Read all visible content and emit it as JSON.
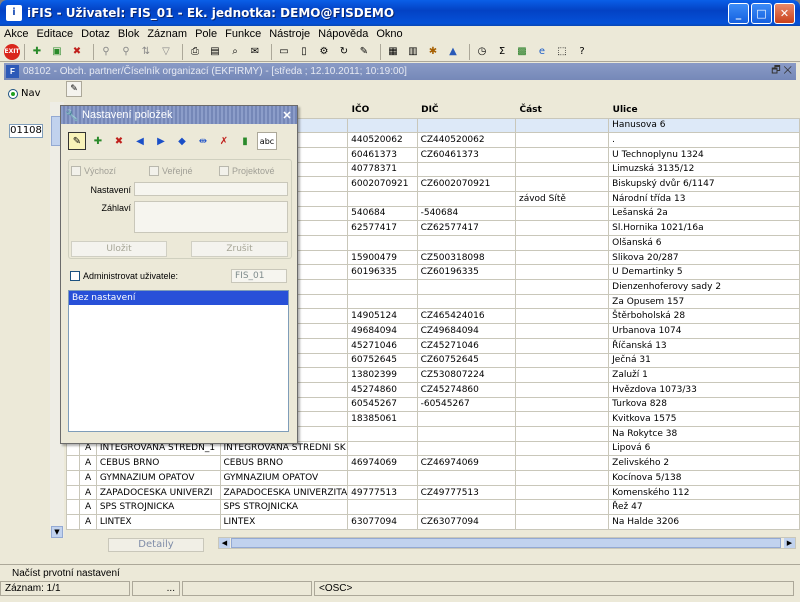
{
  "window": {
    "title": "iFIS - Uživatel: FIS_01 - Ek. jednotka: DEMO@FISDEMO",
    "app_icon": "iFIS"
  },
  "menu": [
    "Akce",
    "Editace",
    "Dotaz",
    "Blok",
    "Záznam",
    "Pole",
    "Funkce",
    "Nástroje",
    "Nápověda",
    "Okno"
  ],
  "toolbar": {
    "exit_label": "EXIT"
  },
  "inner_window": {
    "title": "08102 - Obch. partner/Číselník organizací (EKFIRMY) - [středa ; 12.10.2011; 10:19:00]",
    "controls": "🗗 ✕"
  },
  "left_panel": {
    "nav_label": "Nav",
    "number": "01108",
    "detail_button": "Detaily"
  },
  "grid": {
    "headers": [
      "",
      "",
      "",
      "",
      "IČO",
      "DIČ",
      "Část",
      "Ulice"
    ],
    "rows": [
      {
        "f": "",
        "n": "",
        "n2": "",
        "ico": "",
        "dic": "",
        "cast": "",
        "ulice": "Hanusova 6"
      },
      {
        "f": "",
        "n": "",
        "n2": "MERA",
        "ico": "440520062",
        "dic": "CZ440520062",
        "cast": "",
        "ulice": "."
      },
      {
        "f": "",
        "n": "",
        "n2": "CHENIE A",
        "ico": "60461373",
        "dic": "CZ60461373",
        "cast": "",
        "ulice": "U Technoplynu 1324"
      },
      {
        "f": "",
        "n": "",
        "n2": "k - GEOPI",
        "ico": "40778371",
        "dic": "",
        "cast": "",
        "ulice": "Limuzská 3135/12"
      },
      {
        "f": "",
        "n": "",
        "n2": "CO",
        "ico": "6002070921",
        "dic": "CZ6002070921",
        "cast": "",
        "ulice": "Biskupský dvůr 6/1147"
      },
      {
        "f": "",
        "n": "",
        "n2": "AR",
        "ico": "",
        "dic": "",
        "cast": "závod Sítě",
        "ulice": "Národní třída 13"
      },
      {
        "f": "",
        "n": "",
        "n2": "",
        "ico": "540684",
        "dic": "-540684",
        "cast": "",
        "ulice": "Lešanská 2a"
      },
      {
        "f": "",
        "n": "",
        "n2": "MIA",
        "ico": "62577417",
        "dic": "CZ62577417",
        "cast": "",
        "ulice": "Sl.Hornika 1021/16a"
      },
      {
        "f": "",
        "n": "",
        "n2": "TIN",
        "ico": "",
        "dic": "",
        "cast": "",
        "ulice": "Olšanská 6"
      },
      {
        "f": "",
        "n": "",
        "n2": "",
        "ico": "15900479",
        "dic": "CZ500318098",
        "cast": "",
        "ulice": "Slikova 20/287"
      },
      {
        "f": "",
        "n": "",
        "n2": "S.",
        "ico": "60196335",
        "dic": "CZ60196335",
        "cast": "",
        "ulice": "U Demartinky 5"
      },
      {
        "f": "",
        "n": "",
        "n2": "",
        "ico": "",
        "dic": "",
        "cast": "",
        "ulice": "Dienzenhoferovy sady 2"
      },
      {
        "f": "",
        "n": "",
        "n2": "",
        "ico": "",
        "dic": "",
        "cast": "",
        "ulice": "Za Opusem 157"
      },
      {
        "f": "",
        "n": "",
        "n2": "EKLADA",
        "ico": "14905124",
        "dic": "CZ465424016",
        "cast": "",
        "ulice": "Štěrboholská 28"
      },
      {
        "f": "",
        "n": "",
        "n2": "",
        "ico": "49684094",
        "dic": "CZ49684094",
        "cast": "",
        "ulice": "Urbanova 1074"
      },
      {
        "f": "",
        "n": "",
        "n2": "S.R.O.",
        "ico": "45271046",
        "dic": "CZ45271046",
        "cast": "",
        "ulice": "Říčanská 13"
      },
      {
        "f": "",
        "n": "",
        "n2": "",
        "ico": "60752645",
        "dic": "CZ60752645",
        "cast": "",
        "ulice": "Ječná 31"
      },
      {
        "f": "",
        "n": "",
        "n2": "Ř POKO",
        "ico": "13802399",
        "dic": "CZ530807224",
        "cast": "",
        "ulice": "Zaluží 1"
      },
      {
        "f": "",
        "n": "",
        "n2": "NIHO INZE",
        "ico": "45274860",
        "dic": "CZ45274860",
        "cast": "",
        "ulice": "Hvězdova 1073/33"
      },
      {
        "f": "",
        "n": "",
        "n2": "EDNI SK",
        "ico": "60545267",
        "dic": "-60545267",
        "cast": "",
        "ulice": "Turkova 828"
      },
      {
        "f": "",
        "n": "",
        "n2": "STAVEBI",
        "ico": "18385061",
        "dic": "",
        "cast": "",
        "ulice": "Kvitkova 1575"
      },
      {
        "f": "",
        "n": "",
        "n2": "IKACNI U",
        "ico": "",
        "dic": "",
        "cast": "",
        "ulice": "Na Rokytce 38"
      },
      {
        "f": "A",
        "n": "INTEGROVANA STREDN_1",
        "n2": "INTEGROVANA STREDNI SK",
        "ico": "",
        "dic": "",
        "cast": "",
        "ulice": "Lipová 6"
      },
      {
        "f": "A",
        "n": "CEBUS BRNO",
        "n2": "CEBUS BRNO",
        "ico": "46974069",
        "dic": "CZ46974069",
        "cast": "",
        "ulice": "Zelivského 2"
      },
      {
        "f": "A",
        "n": "GYMNAZIUM OPATOV",
        "n2": "GYMNAZIUM OPATOV",
        "ico": "",
        "dic": "",
        "cast": "",
        "ulice": "Kocínova 5/138"
      },
      {
        "f": "A",
        "n": "ZAPADOCESKA UNIVERZI",
        "n2": "ZAPADOCESKA UNIVERZITA",
        "ico": "49777513",
        "dic": "CZ49777513",
        "cast": "",
        "ulice": "Komenského 112"
      },
      {
        "f": "A",
        "n": "SPS STROJNICKA",
        "n2": "SPS STROJNICKA",
        "ico": "",
        "dic": "",
        "cast": "",
        "ulice": "Řež 47"
      },
      {
        "f": "A",
        "n": "LINTEX",
        "n2": "LINTEX",
        "ico": "63077094",
        "dic": "CZ63077094",
        "cast": "",
        "ulice": "Na Halde 3206"
      }
    ]
  },
  "dialog": {
    "title": "Nastavení položek",
    "abc_label": "abc",
    "checkbox_vychozi": "Výchozí",
    "checkbox_verejne": "Veřejné",
    "checkbox_projektove": "Projektové",
    "label_nastaveni": "Nastavení",
    "label_zahlavi": "Záhlaví",
    "button_ulozit": "Uložit",
    "button_zrusit": "Zrušit",
    "checkbox_admin": "Administrovat uživatele:",
    "user_field": "FIS_01",
    "list_selected": "Bez nastavení"
  },
  "status": {
    "message": "Načíst prvotní nastavení",
    "record": "Záznam: 1/1",
    "dots": "...",
    "osc": "<OSC>"
  }
}
